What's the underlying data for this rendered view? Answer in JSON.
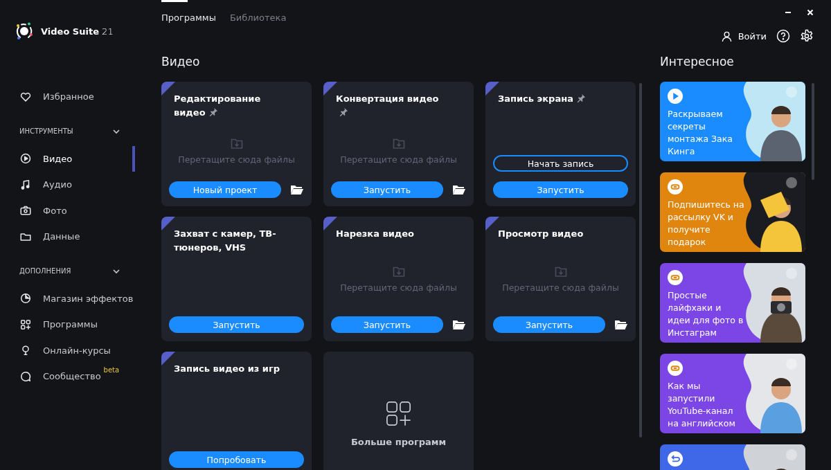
{
  "app": {
    "name": "Video Suite",
    "version": "21"
  },
  "sidebar": {
    "favorites": {
      "label": "Избранное",
      "selected": false
    },
    "sections": [
      {
        "title": "ИНСТРУМЕНТЫ",
        "expanded": true,
        "items": [
          {
            "label": "Видео",
            "selected": true
          },
          {
            "label": "Аудио",
            "selected": false
          },
          {
            "label": "Фото",
            "selected": false
          },
          {
            "label": "Данные",
            "selected": false
          }
        ]
      },
      {
        "title": "ДОПОЛНЕНИЯ",
        "expanded": true,
        "items": [
          {
            "label": "Магазин эффектов",
            "selected": false
          },
          {
            "label": "Программы",
            "selected": false
          },
          {
            "label": "Онлайн-курсы",
            "selected": false
          },
          {
            "label": "Сообщество",
            "selected": false,
            "badge": "beta"
          }
        ]
      }
    ]
  },
  "tabs": [
    {
      "label": "Программы",
      "selected": true
    },
    {
      "label": "Библиотека",
      "selected": false
    }
  ],
  "header": {
    "login": "Войти"
  },
  "video": {
    "title": "Видео",
    "cards": [
      {
        "kind": "app",
        "title": "Редактирование видео",
        "pinned": true,
        "drop_hint": "Перетащите сюда файлы",
        "buttons": [
          {
            "kind": "primary",
            "label": "Новый проект"
          }
        ],
        "folder": true
      },
      {
        "kind": "app",
        "title": "Конвертация видео",
        "pinned": true,
        "drop_hint": "Перетащите сюда файлы",
        "buttons": [
          {
            "kind": "primary",
            "label": "Запустить"
          }
        ],
        "folder": true
      },
      {
        "kind": "app",
        "title": "Запись экрана",
        "pinned": true,
        "buttons": [
          {
            "kind": "outline",
            "label": "Начать запись"
          },
          {
            "kind": "primary",
            "label": "Запустить"
          }
        ],
        "folder": false
      },
      {
        "kind": "app",
        "title": "Захват с камер, ТВ-тюнеров, VHS",
        "pinned": false,
        "buttons": [
          {
            "kind": "primary",
            "label": "Запустить"
          }
        ],
        "folder": false
      },
      {
        "kind": "app",
        "title": "Нарезка видео",
        "pinned": false,
        "drop_hint": "Перетащите сюда файлы",
        "buttons": [
          {
            "kind": "primary",
            "label": "Запустить"
          }
        ],
        "folder": true
      },
      {
        "kind": "app",
        "title": "Просмотр видео",
        "pinned": false,
        "drop_hint": "Перетащите сюда файлы",
        "buttons": [
          {
            "kind": "primary",
            "label": "Запустить"
          }
        ],
        "folder": true
      },
      {
        "kind": "app",
        "title": "Запись видео из игр",
        "pinned": false,
        "buttons": [
          {
            "kind": "primary",
            "label": "Попробовать"
          }
        ],
        "folder": false
      },
      {
        "kind": "more",
        "title": "Больше программ"
      }
    ]
  },
  "interesting": {
    "title": "Интересное",
    "cards": [
      {
        "color": "#1a8cff",
        "text": "Раскрываем секреты монтажа Зака Кинга"
      },
      {
        "color": "#e0860f",
        "text": "Подпишитесь на рассылку VK и получите подарок"
      },
      {
        "color": "#7c45e6",
        "text": "Простые лайфхаки и идеи для фото в Инстаграм"
      },
      {
        "color": "#7c45e6",
        "text": "Как мы запустили YouTube-канал на английском"
      },
      {
        "color": "#3f68e8"
      }
    ]
  }
}
